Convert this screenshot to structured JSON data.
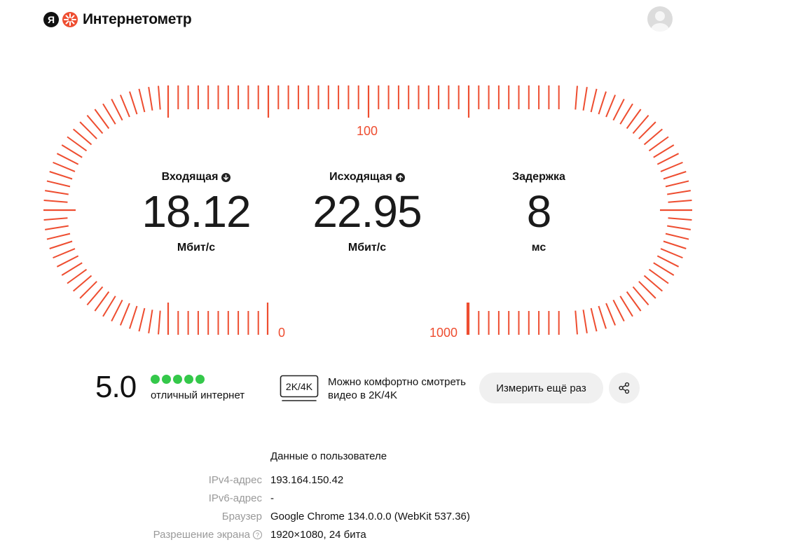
{
  "header": {
    "logo_badge": "Я",
    "logo_text": "Интернетометр"
  },
  "colors": {
    "accent": "#ee4d30",
    "star": "#34c84a",
    "button_bg": "#f0f0f0"
  },
  "gauge": {
    "label_top": "100",
    "label_left": "0",
    "label_right": "1000"
  },
  "metrics": {
    "download": {
      "title": "Входящая",
      "value": "18.12",
      "unit": "Мбит/с",
      "icon": "arrow-down-icon"
    },
    "upload": {
      "title": "Исходящая",
      "value": "22.95",
      "unit": "Мбит/с",
      "icon": "arrow-up-icon"
    },
    "latency": {
      "title": "Задержка",
      "value": "8",
      "unit": "мс"
    }
  },
  "rating": {
    "score": "5.0",
    "stars": 5,
    "label": "отличный интернет"
  },
  "video": {
    "badge": "2K/4K",
    "text": "Можно комфортно смотреть видео в 2K/4K"
  },
  "actions": {
    "measure_again": "Измерить ещё раз",
    "share_icon": "share-icon"
  },
  "user_info": {
    "heading": "Данные о пользователе",
    "rows": [
      {
        "label": "IPv4-адрес",
        "value": "193.164.150.42"
      },
      {
        "label": "IPv6-адрес",
        "value": "-"
      },
      {
        "label": "Браузер",
        "value": "Google Chrome 134.0.0.0 (WebKit 537.36)"
      },
      {
        "label": "Разрешение экрана",
        "value": "1920×1080, 24 бита",
        "help": "?"
      }
    ]
  }
}
